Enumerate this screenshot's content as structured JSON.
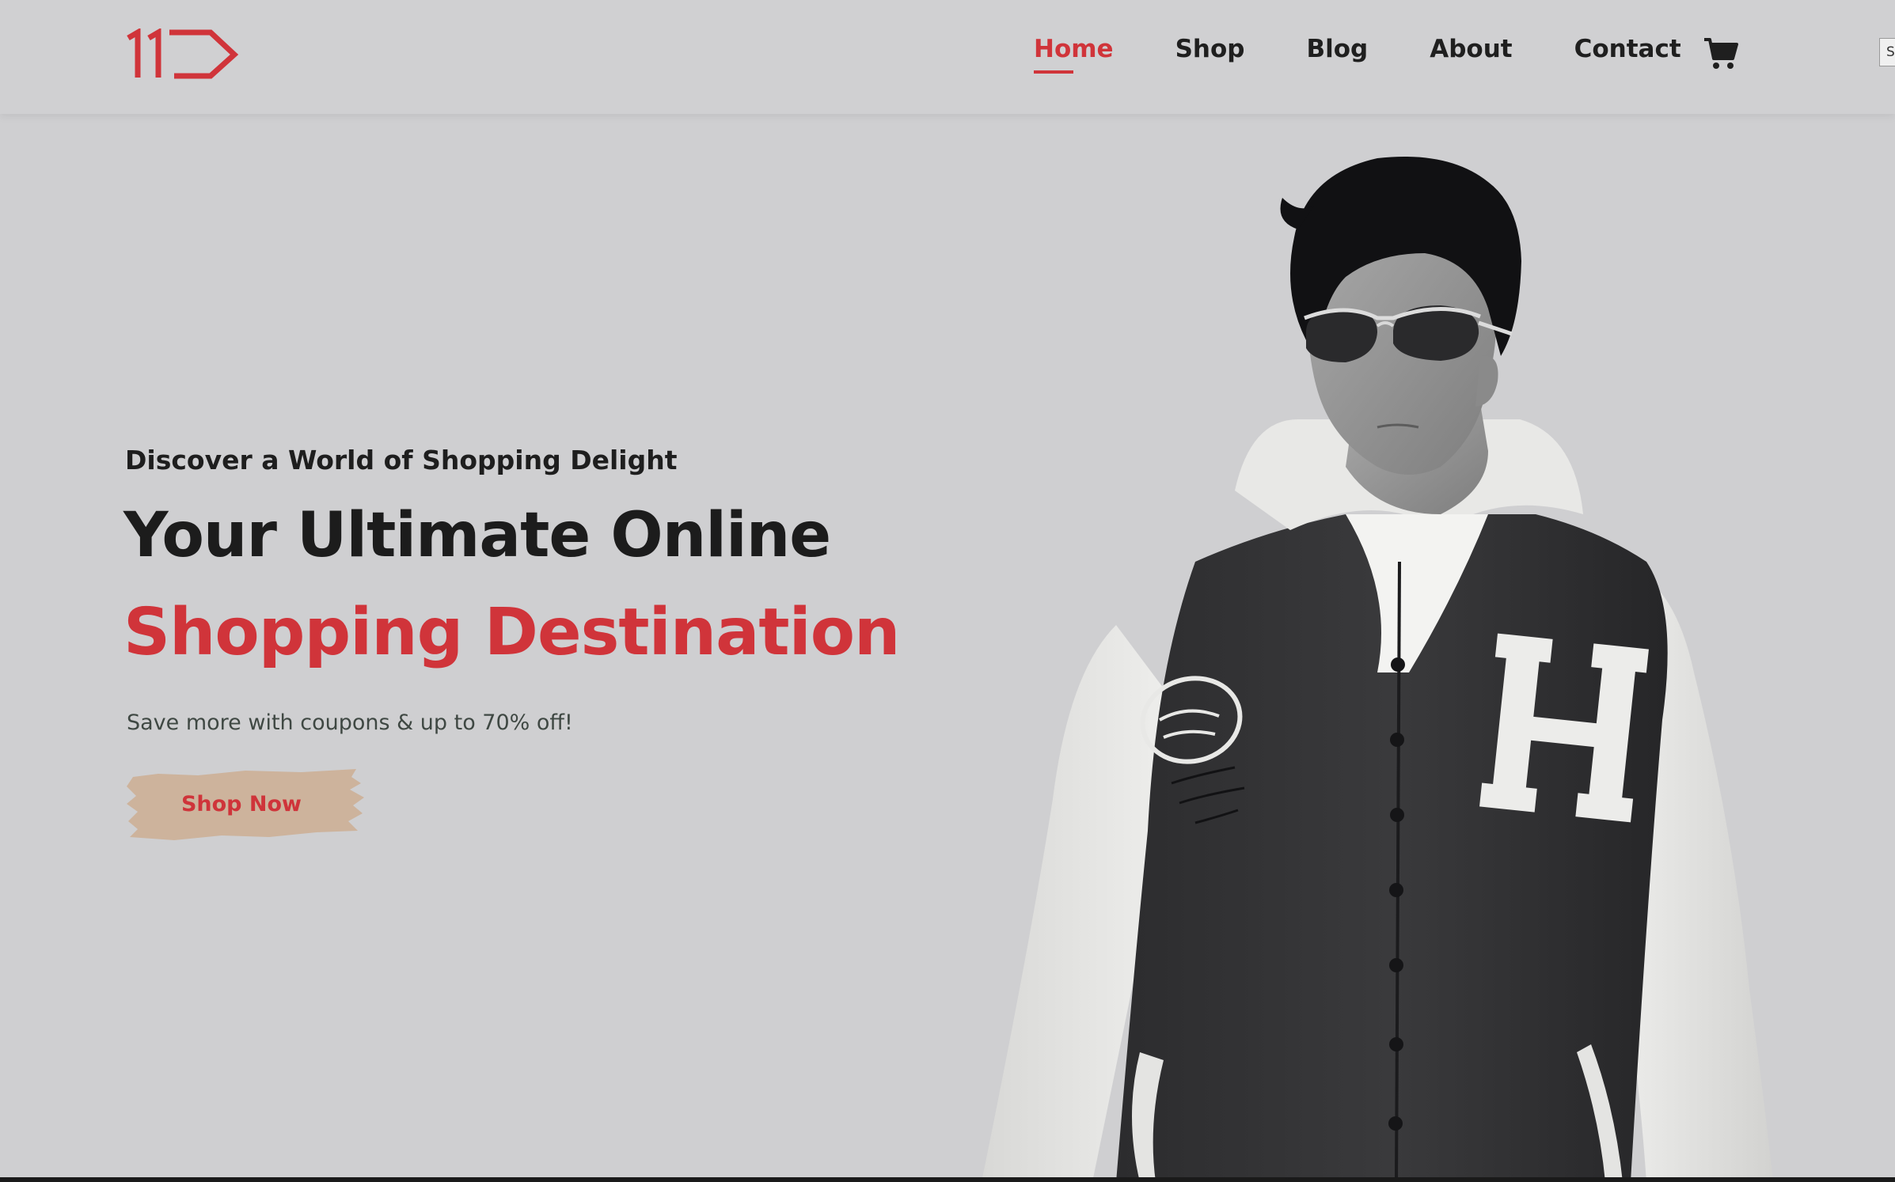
{
  "header": {
    "logo_text": "1D",
    "nav": [
      {
        "label": "Home",
        "active": true
      },
      {
        "label": "Shop",
        "active": false
      },
      {
        "label": "Blog",
        "active": false
      },
      {
        "label": "About",
        "active": false
      },
      {
        "label": "Contact",
        "active": false
      }
    ],
    "cart_icon": "cart-icon",
    "edge_tab_text": "S"
  },
  "hero": {
    "eyebrow": "Discover a World of Shopping Delight",
    "headline_line1": "Your Ultimate Online",
    "headline_line2": "Shopping Destination",
    "tagline": "Save more with coupons & up to 70% off!",
    "cta_label": "Shop Now",
    "image_subject": "model-in-varsity-jacket"
  },
  "colors": {
    "accent": "#d0343a",
    "background": "#cfcfd1",
    "text_dark": "#1c1c1c",
    "button_brush": "#cdb39c"
  }
}
